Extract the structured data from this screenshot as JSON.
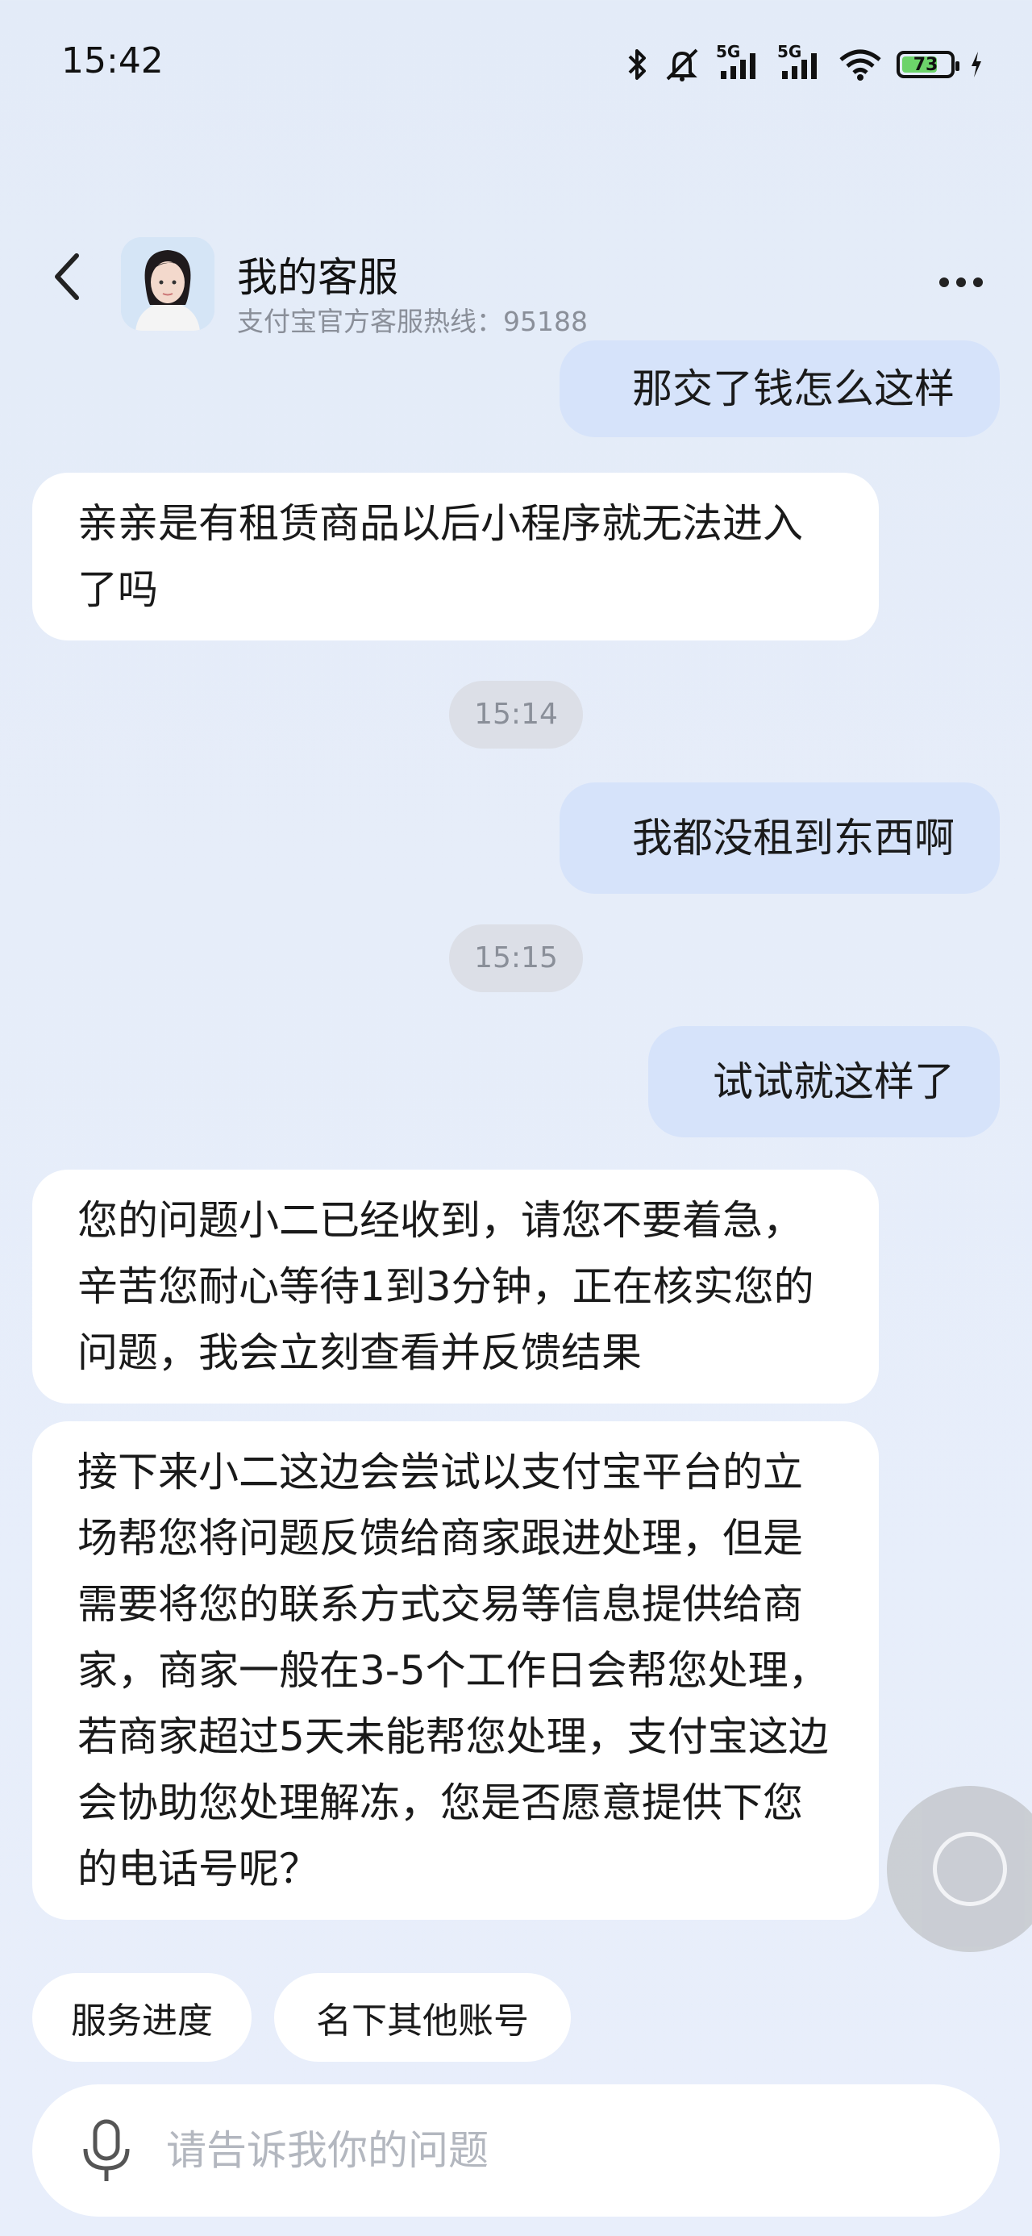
{
  "status_bar": {
    "time": "15:42",
    "battery": "73",
    "battery_level": 0.73,
    "network_1": "5G",
    "network_2": "5G",
    "icons": [
      "bluetooth-icon",
      "mute-icon",
      "signal-5g-icon",
      "signal-5g-icon",
      "wifi-icon",
      "battery-icon",
      "charging-icon"
    ]
  },
  "header": {
    "title": "我的客服",
    "subtitle": "支付宝官方客服热线：95188"
  },
  "messages": [
    {
      "role": "user",
      "text": "那交了钱怎么这样"
    },
    {
      "role": "agent",
      "text": "亲亲是有租赁商品以后小程序就无法进入了吗"
    },
    {
      "role": "time",
      "text": "15:14"
    },
    {
      "role": "user",
      "text": "我都没租到东西啊"
    },
    {
      "role": "time",
      "text": "15:15"
    },
    {
      "role": "user",
      "text": "试试就这样了"
    },
    {
      "role": "agent",
      "text": "您的问题小二已经收到，请您不要着急，辛苦您耐心等待1到3分钟，正在核实您的问题，我会立刻查看并反馈结果"
    },
    {
      "role": "agent",
      "text": "接下来小二这边会尝试以支付宝平台的立场帮您将问题反馈给商家跟进处理，但是需要将您的联系方式交易等信息提供给商家，商家一般在3-5个工作日会帮您处理，若商家超过5天未能帮您处理，支付宝这边会协助您处理解冻，您是否愿意提供下您的电话号呢？"
    }
  ],
  "quick_replies": [
    "服务进度",
    "名下其他账号"
  ],
  "input": {
    "placeholder": "请告诉我你的问题"
  },
  "colors": {
    "user_bubble": "#d6e3fa",
    "agent_bubble": "#ffffff",
    "background": "#e5ecf9"
  }
}
